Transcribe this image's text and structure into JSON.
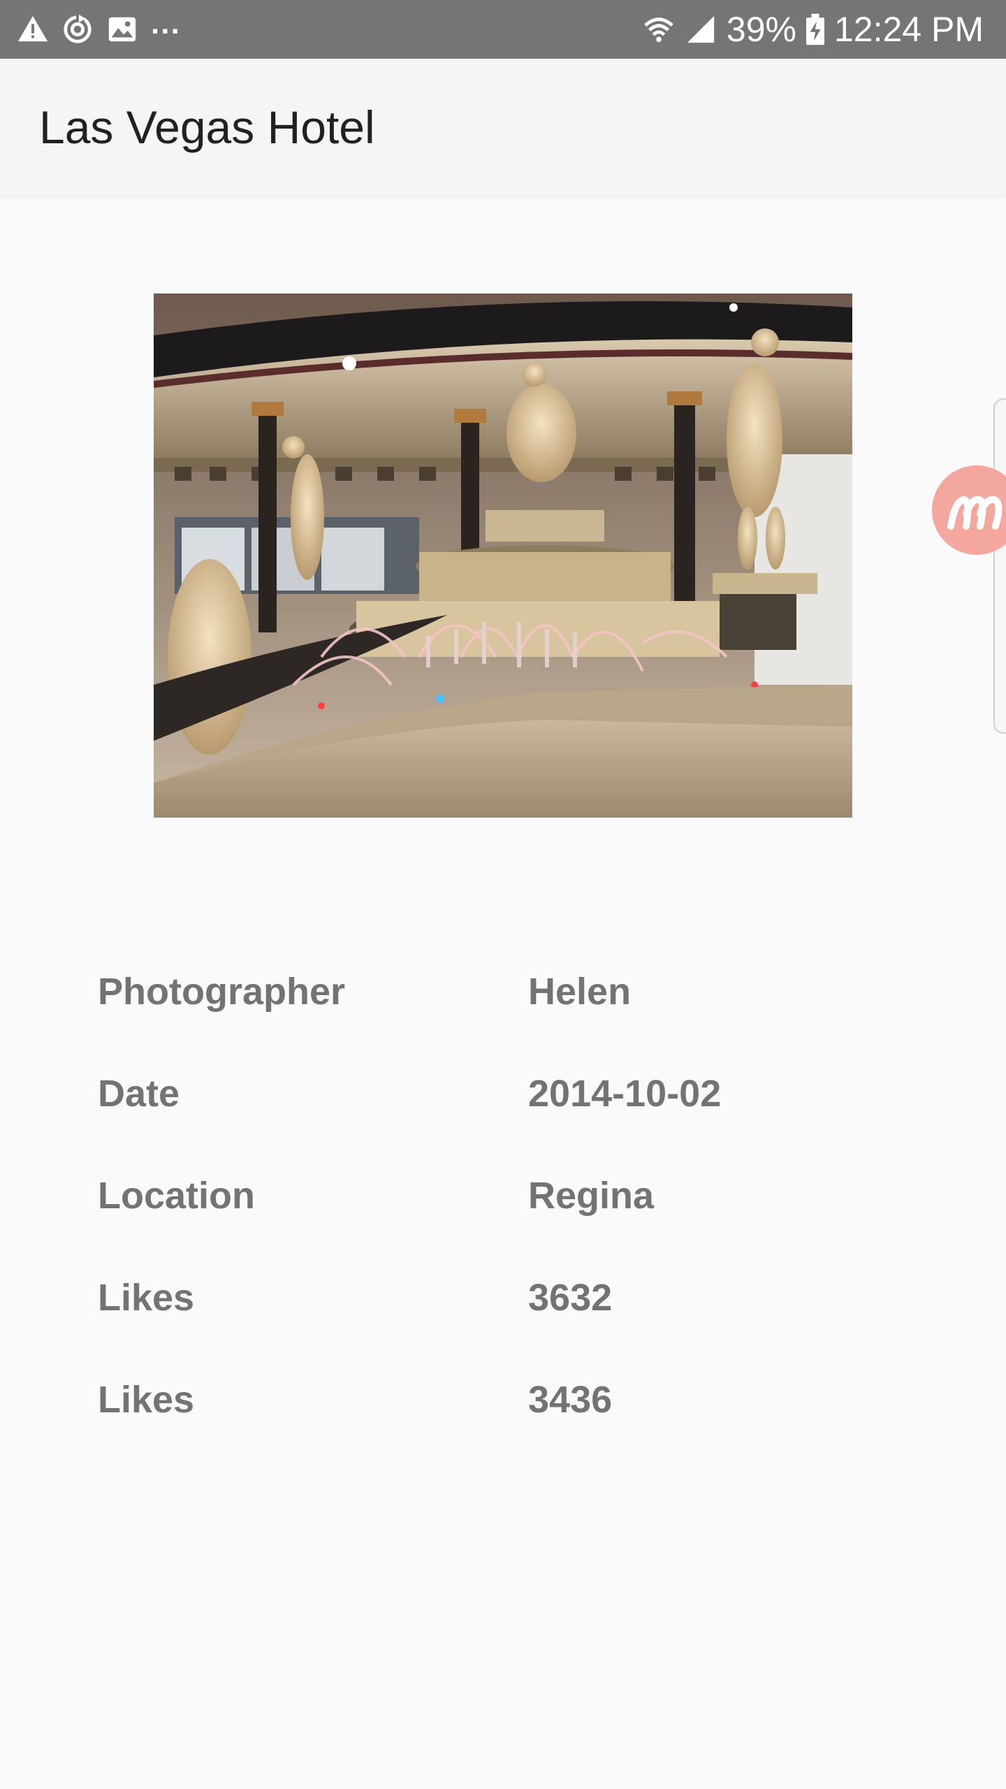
{
  "status_bar": {
    "battery_percent": "39%",
    "time": "12:24 PM",
    "overflow_indicator": "...",
    "left_icons": [
      "warning-icon",
      "sync-icon",
      "image-icon"
    ],
    "right_icons": [
      "wifi-icon",
      "signal-icon",
      "battery-charging-icon"
    ]
  },
  "app_bar": {
    "title": "Las Vegas Hotel"
  },
  "photo": {
    "subject": "fountain-statues"
  },
  "details": [
    {
      "label": "Photographer",
      "value": "Helen"
    },
    {
      "label": "Date",
      "value": "2014-10-02"
    },
    {
      "label": "Location",
      "value": "Regina"
    },
    {
      "label": "Likes",
      "value": "3632"
    },
    {
      "label": "Likes",
      "value": "3436"
    }
  ],
  "colors": {
    "status_bar": "#757575",
    "app_bar": "#f5f5f5",
    "background": "#fafafa",
    "detail_text": "#737373",
    "badge": "#f3a79f"
  }
}
